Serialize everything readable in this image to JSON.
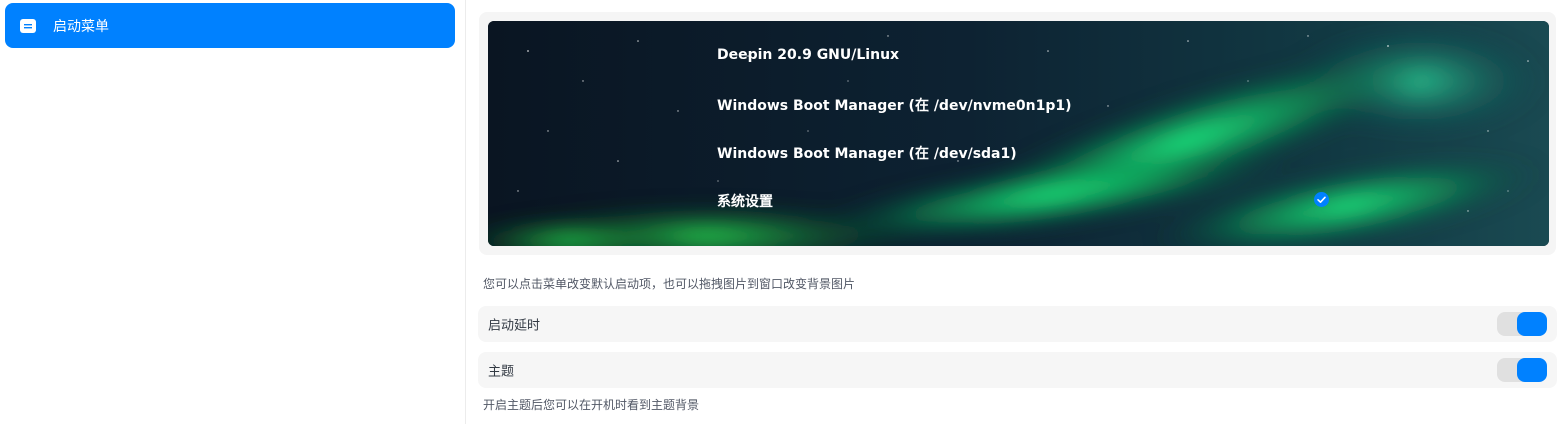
{
  "sidebar": {
    "items": [
      {
        "label": "启动菜单",
        "icon": "menu-icon",
        "active": true
      }
    ]
  },
  "boot_menu": {
    "entries": [
      {
        "label": "Deepin 20.9 GNU/Linux"
      },
      {
        "label": "Windows Boot Manager (在 /dev/nvme0n1p1)"
      },
      {
        "label": "Windows Boot Manager (在 /dev/sda1)"
      },
      {
        "label": "系统设置",
        "default": true
      }
    ],
    "default_icon": "check-circle-icon"
  },
  "hint_text": "您可以点击菜单改变默认启动项，也可以拖拽图片到窗口改变背景图片",
  "settings": {
    "boot_delay": {
      "label": "启动延时",
      "enabled": true
    },
    "theme": {
      "label": "主题",
      "enabled": true
    }
  },
  "theme_hint": "开启主题后您可以在开机时看到主题背景",
  "colors": {
    "accent": "#0081ff",
    "row_bg": "#f6f6f6",
    "switch_track": "#e0e0e0"
  }
}
